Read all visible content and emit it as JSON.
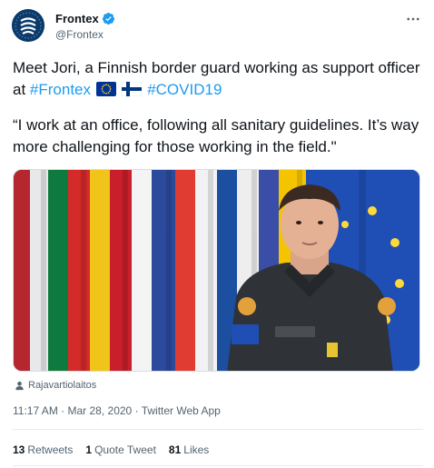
{
  "author": {
    "display_name": "Frontex",
    "handle": "@Frontex",
    "avatar_icon": "frontex-logo-icon",
    "verified_icon": "verified-badge-icon",
    "brand_color": "#0b3a6b"
  },
  "tweet": {
    "line1_text": "Meet Jori, a Finnish border guard working as support officer at ",
    "hashtag_frontex": "#Frontex",
    "hashtag_covid": "#COVID19",
    "flag_eu_icon": "eu-flag-icon",
    "flag_fi_icon": "finland-flag-icon",
    "quote": "“I work at an office, following all sanitary guidelines. It’s way more challenging for those working in the field.\""
  },
  "media": {
    "credit": "Rajavartiolaitos",
    "credit_icon": "person-icon"
  },
  "meta": {
    "time": "11:17 AM",
    "separator": "·",
    "date": "Mar 28, 2020",
    "source": "Twitter Web App"
  },
  "stats": {
    "retweets_count": "13",
    "retweets_label": "Retweets",
    "quotes_count": "1",
    "quotes_label": "Quote Tweet",
    "likes_count": "81",
    "likes_label": "Likes"
  },
  "colors": {
    "link": "#1d9bf0",
    "secondary_text": "#536471",
    "primary_text": "#0f1419"
  }
}
